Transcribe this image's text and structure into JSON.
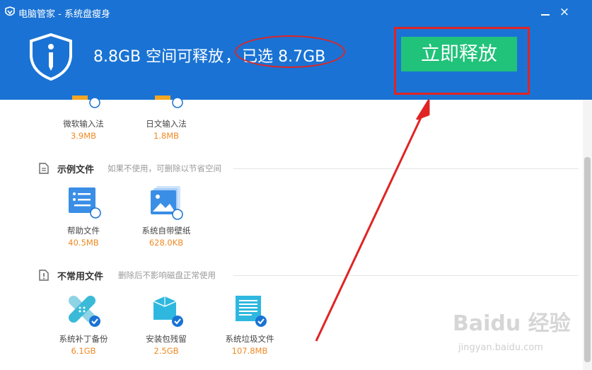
{
  "window": {
    "title": "电脑管家 - 系统盘瘦身",
    "close_glyph": "×"
  },
  "summary": {
    "releasable": "8.8GB 空间可释放",
    "sep": "，",
    "selected": "已选 8.7GB"
  },
  "release_button": "立即释放",
  "colors": {
    "header": "#1a73d4",
    "accent_green": "#21c27a",
    "size_orange": "#f08a24",
    "annotation_red": "#e02424"
  },
  "top_items": [
    {
      "name": "微软输入法",
      "size": "3.9MB",
      "icon": "input-method-icon",
      "checked": false
    },
    {
      "name": "日文输入法",
      "size": "1.8MB",
      "icon": "input-method-icon",
      "checked": false
    }
  ],
  "sections": [
    {
      "title": "示例文件",
      "desc": "如果不使用，可删除以节省空间",
      "items": [
        {
          "name": "帮助文件",
          "size": "40.5MB",
          "icon": "help-file-icon",
          "checked": false
        },
        {
          "name": "系统自带壁纸",
          "size": "628.0KB",
          "icon": "wallpaper-icon",
          "checked": false
        }
      ]
    },
    {
      "title": "不常用文件",
      "desc": "删除后不影响磁盘正常使用",
      "items": [
        {
          "name": "系统补丁备份",
          "size": "6.1GB",
          "icon": "patch-bandage-icon",
          "checked": true
        },
        {
          "name": "安装包残留",
          "size": "2.5GB",
          "icon": "package-box-icon",
          "checked": true
        },
        {
          "name": "系统垃圾文件",
          "size": "107.8MB",
          "icon": "system-junk-icon",
          "checked": true
        }
      ]
    }
  ],
  "watermark": {
    "logo": "Baidu 经验",
    "url": "jingyan.baidu.com"
  }
}
